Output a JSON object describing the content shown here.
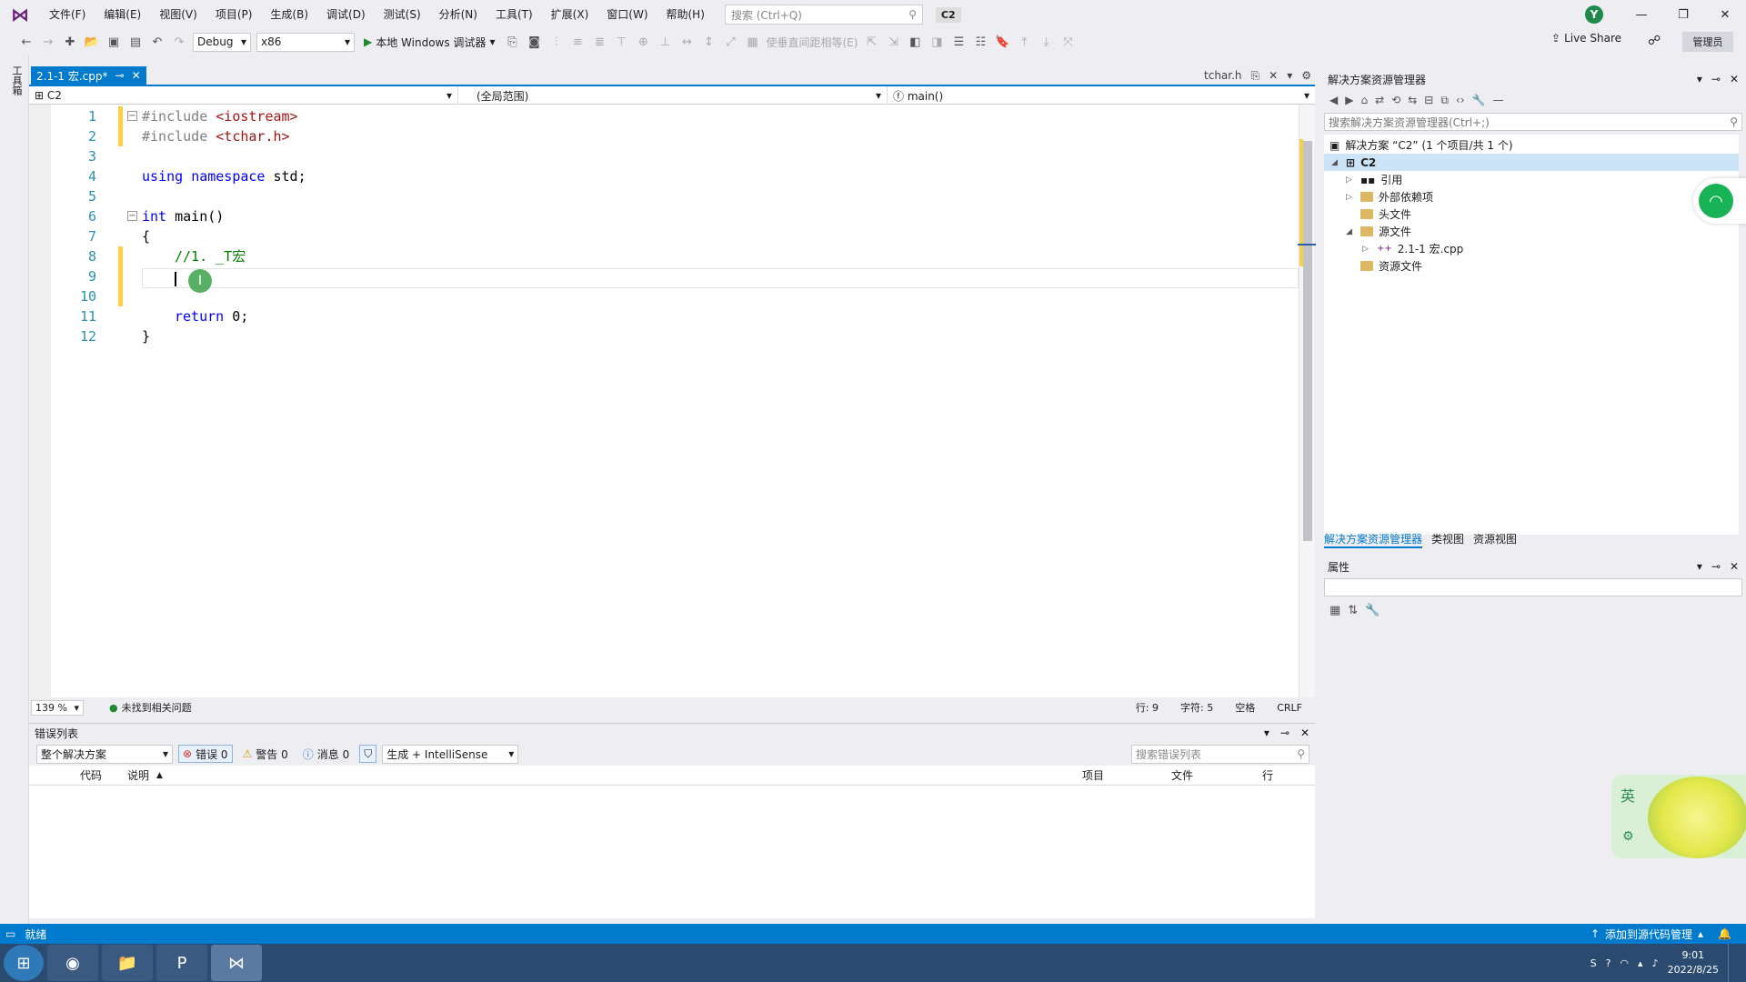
{
  "menubar": {
    "items": [
      "文件(F)",
      "编辑(E)",
      "视图(V)",
      "项目(P)",
      "生成(B)",
      "调试(D)",
      "测试(S)",
      "分析(N)",
      "工具(T)",
      "扩展(X)",
      "窗口(W)",
      "帮助(H)"
    ],
    "search_placeholder": "搜索 (Ctrl+Q)",
    "project_badge": "C2",
    "avatar": "Y"
  },
  "toolbar": {
    "config": "Debug",
    "platform": "x86",
    "run_label": "本地 Windows 调试器",
    "align_label": "使垂直间距相等(E)",
    "live_share": "Live Share",
    "admin": "管理员"
  },
  "left_strip": {
    "label": "工具箱"
  },
  "tabs": {
    "active": "2.1-1 宏.cpp*",
    "other": "tchar.h"
  },
  "navbar": {
    "project": "C2",
    "scope": "(全局范围)",
    "member": "main()"
  },
  "code": {
    "line_numbers": [
      "1",
      "2",
      "3",
      "4",
      "5",
      "6",
      "7",
      "8",
      "9",
      "10",
      "11",
      "12"
    ],
    "l1_pp": "#include ",
    "l1_inc": "<iostream>",
    "l2_pp": "#include ",
    "l2_inc": "<tchar.h>",
    "l4_kw1": "using",
    "l4_kw2": "namespace",
    "l4_rest": " std;",
    "l6_kw": "int",
    "l6_rest": " main()",
    "l7": "{",
    "l8_comment": "//1. _T宏",
    "l11_kw": "return",
    "l11_rest": " 0;",
    "l12": "}"
  },
  "editor_status": {
    "zoom": "139 %",
    "issues": "未找到相关问题",
    "line": "行: 9",
    "char": "字符: 5",
    "whitespace": "空格",
    "eol": "CRLF"
  },
  "error_list": {
    "title": "错误列表",
    "scope": "整个解决方案",
    "errors": "错误 0",
    "warnings": "警告 0",
    "messages": "消息 0",
    "build_filter": "生成 + IntelliSense",
    "search_placeholder": "搜索错误列表",
    "columns": [
      "代码",
      "说明",
      "项目",
      "文件",
      "行"
    ]
  },
  "solution_explorer": {
    "title": "解决方案资源管理器",
    "search_placeholder": "搜索解决方案资源管理器(Ctrl+;)",
    "solution": "解决方案 “C2” (1 个项目/共 1 个)",
    "project": "C2",
    "nodes": [
      "引用",
      "外部依赖项",
      "头文件",
      "源文件",
      "2.1-1 宏.cpp",
      "资源文件"
    ],
    "tabs": [
      "解决方案资源管理器",
      "类视图",
      "资源视图"
    ]
  },
  "properties": {
    "title": "属性"
  },
  "statusbar": {
    "ready": "就绪",
    "source_control": "添加到源代码管理"
  },
  "taskbar": {
    "time": "9:01",
    "date": "2022/8/25"
  },
  "ime": {
    "lang": "英"
  },
  "colors": {
    "accent": "#007acc",
    "vs_purple": "#68217a",
    "keyword": "#0000ff",
    "comment": "#008000",
    "include": "#a31515"
  }
}
